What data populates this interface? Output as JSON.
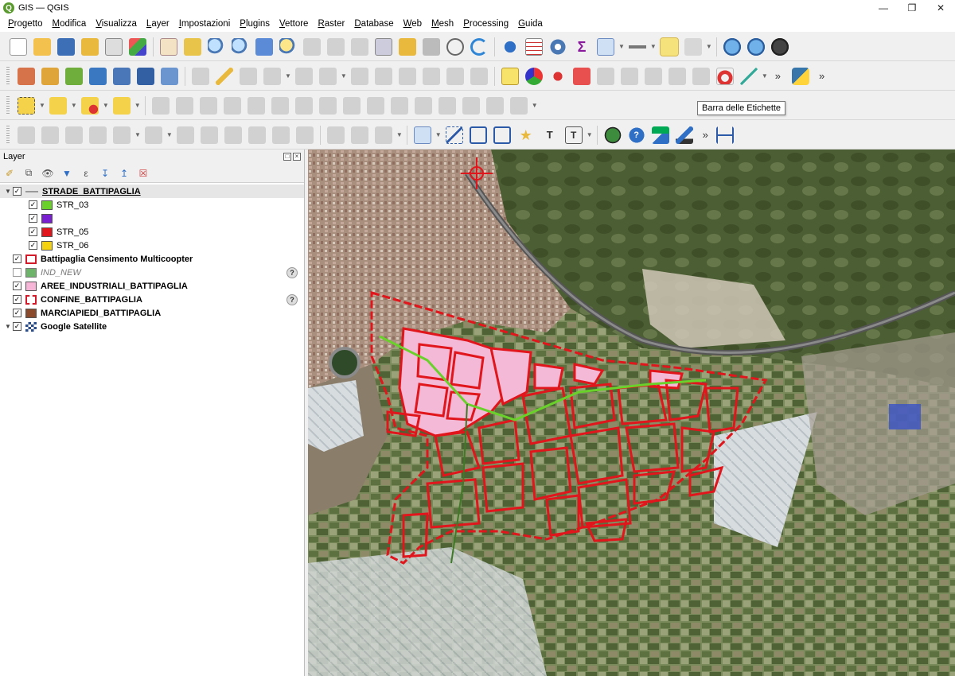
{
  "window": {
    "title": "GIS — QGIS",
    "logo": "Q"
  },
  "menu": [
    "Progetto",
    "Modifica",
    "Visualizza",
    "Layer",
    "Impostazioni",
    "Plugins",
    "Vettore",
    "Raster",
    "Database",
    "Web",
    "Mesh",
    "Processing",
    "Guida"
  ],
  "tooltip": "Barra delle Etichette",
  "layer_panel": {
    "title": "Layer",
    "layers": [
      {
        "name": "STRADE_BATTIPAGLIA",
        "checked": true,
        "expanded": true,
        "style": "bold-underline",
        "icon": "line-layer-icon"
      },
      {
        "name": "STR_03",
        "checked": true,
        "swatch": "#6ad12b",
        "child": true
      },
      {
        "name": "",
        "checked": true,
        "swatch": "#7a1fd1",
        "child": true
      },
      {
        "name": "STR_05",
        "checked": true,
        "swatch": "#e0161c",
        "child": true
      },
      {
        "name": "STR_06",
        "checked": true,
        "swatch": "#f5d20f",
        "child": true
      },
      {
        "name": "Battipaglia Censimento Multicoopter",
        "checked": true,
        "swatch": "#ffffff",
        "swatch_border": "#d11a2a",
        "style": "bold"
      },
      {
        "name": "IND_NEW",
        "checked": false,
        "swatch": "#6db36a",
        "style": "italic",
        "help": true
      },
      {
        "name": "AREE_INDUSTRIALI_BATTIPAGLIA",
        "checked": true,
        "swatch": "#f7b6d8",
        "style": "bold"
      },
      {
        "name": "CONFINE_BATTIPAGLIA",
        "checked": true,
        "swatch": "#ffffff",
        "swatch_border": "#d11a2a",
        "swatch_dashed": true,
        "style": "bold",
        "help": true
      },
      {
        "name": "MARCIAPIEDI_BATTIPAGLIA",
        "checked": true,
        "swatch": "#8b4a2b",
        "style": "bold"
      },
      {
        "name": "Google Satellite",
        "checked": true,
        "expanded": true,
        "style": "bold",
        "icon": "raster-layer-icon"
      }
    ]
  },
  "colors": {
    "accent": "#d11a2a",
    "pink_fill": "#f7b6d8",
    "road_green": "#6ad12b"
  }
}
